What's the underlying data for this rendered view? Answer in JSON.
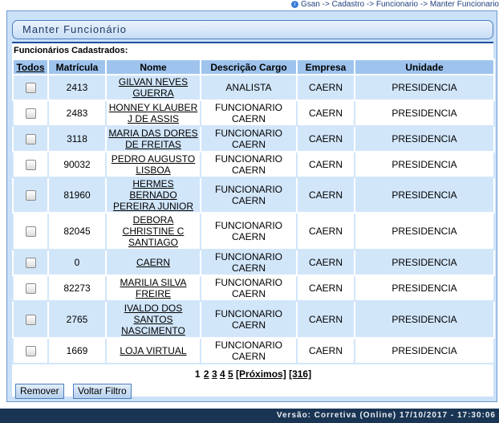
{
  "breadcrumb": "Gsan -> Cadastro -> Funcionario -> Manter Funcionario",
  "page_title": "Manter Funcionário",
  "section_label": "Funcionários Cadastrados:",
  "table": {
    "headers": [
      "Todos",
      "Matrícula",
      "Nome",
      "Descrição Cargo",
      "Empresa",
      "Unidade"
    ],
    "rows": [
      {
        "matricula": "2413",
        "nome": "GILVAN NEVES GUERRA",
        "cargo": "ANALISTA",
        "empresa": "CAERN",
        "unidade": "PRESIDENCIA"
      },
      {
        "matricula": "2483",
        "nome": "HONNEY KLAUBER J DE ASSIS",
        "cargo": "FUNCIONARIO CAERN",
        "empresa": "CAERN",
        "unidade": "PRESIDENCIA"
      },
      {
        "matricula": "3118",
        "nome": "MARIA DAS DORES DE FREITAS",
        "cargo": "FUNCIONARIO CAERN",
        "empresa": "CAERN",
        "unidade": "PRESIDENCIA"
      },
      {
        "matricula": "90032",
        "nome": "PEDRO AUGUSTO LISBOA",
        "cargo": "FUNCIONARIO CAERN",
        "empresa": "CAERN",
        "unidade": "PRESIDENCIA"
      },
      {
        "matricula": "81960",
        "nome": "HERMES BERNADO PEREIRA JUNIOR",
        "cargo": "FUNCIONARIO CAERN",
        "empresa": "CAERN",
        "unidade": "PRESIDENCIA"
      },
      {
        "matricula": "82045",
        "nome": "DEBORA CHRISTINE C SANTIAGO",
        "cargo": "FUNCIONARIO CAERN",
        "empresa": "CAERN",
        "unidade": "PRESIDENCIA"
      },
      {
        "matricula": "0",
        "nome": "CAERN",
        "cargo": "FUNCIONARIO CAERN",
        "empresa": "CAERN",
        "unidade": "PRESIDENCIA"
      },
      {
        "matricula": "82273",
        "nome": "MARILIA SILVA FREIRE",
        "cargo": "FUNCIONARIO CAERN",
        "empresa": "CAERN",
        "unidade": "PRESIDENCIA"
      },
      {
        "matricula": "2765",
        "nome": "IVALDO DOS SANTOS NASCIMENTO",
        "cargo": "FUNCIONARIO CAERN",
        "empresa": "CAERN",
        "unidade": "PRESIDENCIA"
      },
      {
        "matricula": "1669",
        "nome": "LOJA VIRTUAL",
        "cargo": "FUNCIONARIO CAERN",
        "empresa": "CAERN",
        "unidade": "PRESIDENCIA"
      }
    ]
  },
  "pagination": {
    "current": "1",
    "pages": [
      "2",
      "3",
      "4",
      "5"
    ],
    "next": "[Próximos]",
    "last": "[316]"
  },
  "buttons": {
    "remove": "Remover",
    "back_filter": "Voltar Filtro"
  },
  "footer": "Versão: Corretiva (Online) 17/10/2017 - 17:30:06",
  "colors": {
    "frame_bg": "#cbe1f8",
    "header_bg": "#9ec4ee",
    "row_odd_bg": "#d2e6fa",
    "title_rule": "#1e4f9e",
    "footer_bg": "#1a3553"
  },
  "icons": {
    "breadcrumb": "info-circle-icon"
  }
}
